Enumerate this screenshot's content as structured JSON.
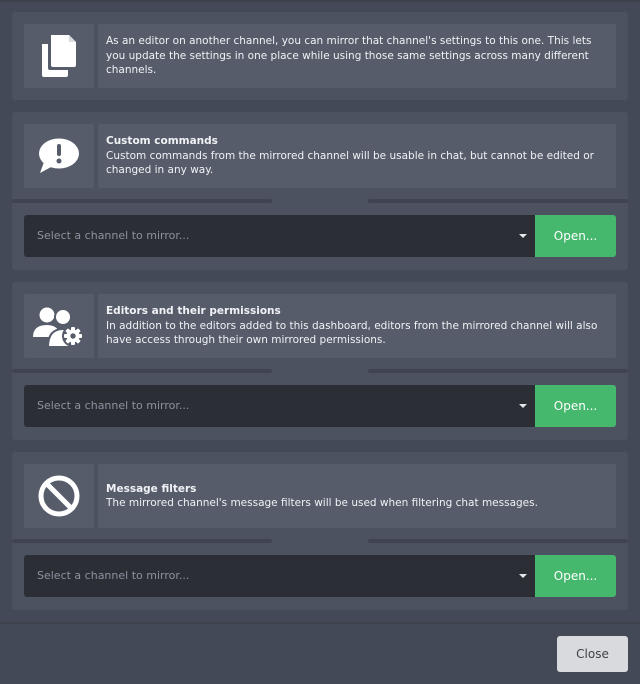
{
  "intro": {
    "icon": "copy-icon",
    "text": "As an editor on another channel, you can mirror that channel's settings to this one. This lets you update the settings in one place while using those same settings across many different channels."
  },
  "sections": [
    {
      "icon": "exclamation-speech-bubble-icon",
      "title": "Custom commands",
      "description": "Custom commands from the mirrored channel will be usable in chat, but cannot be edited or changed in any way.",
      "select_placeholder": "Select a channel to mirror...",
      "open_label": "Open..."
    },
    {
      "icon": "users-gear-icon",
      "title": "Editors and their permissions",
      "description": "In addition to the editors added to this dashboard, editors from the mirrored channel will also have access through their own mirrored permissions.",
      "select_placeholder": "Select a channel to mirror...",
      "open_label": "Open..."
    },
    {
      "icon": "ban-icon",
      "title": "Message filters",
      "description": "The mirrored channel's message filters will be used when filtering chat messages.",
      "select_placeholder": "Select a channel to mirror...",
      "open_label": "Open..."
    }
  ],
  "footer": {
    "close_label": "Close"
  },
  "colors": {
    "background": "#434956",
    "panel": "#4c5260",
    "box": "#565c6a",
    "select": "#2b2e35",
    "open_button": "#45b86d",
    "close_button": "#d9dadd"
  }
}
